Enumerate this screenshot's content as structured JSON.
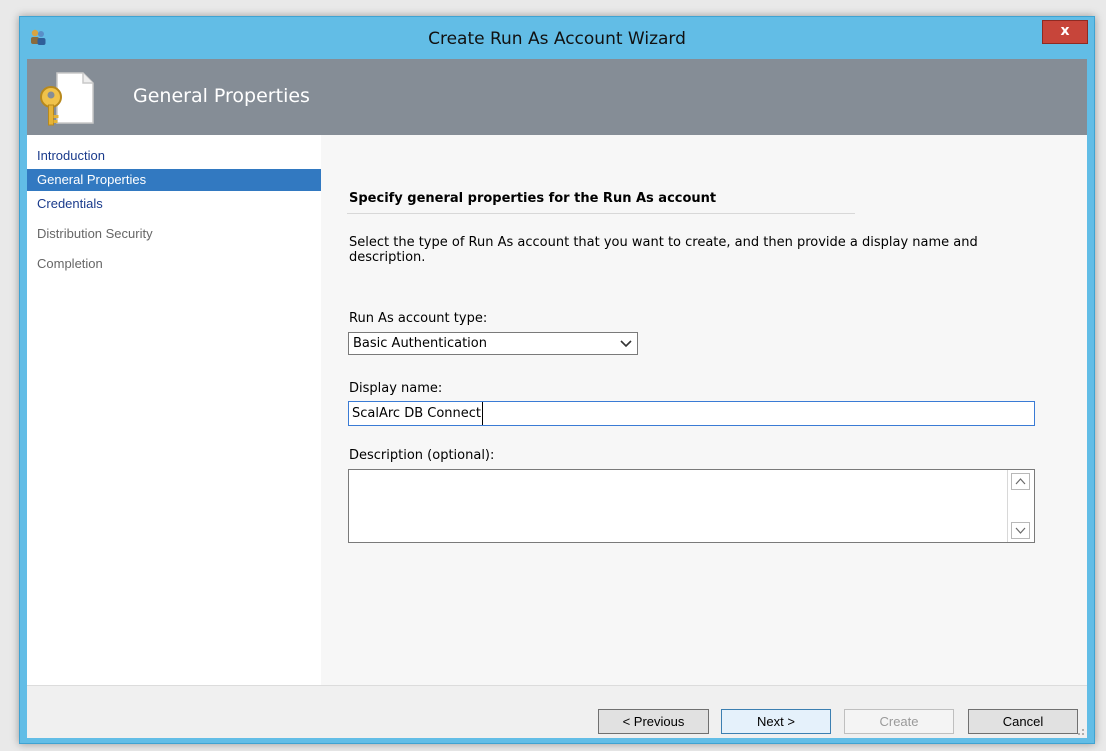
{
  "window": {
    "title": "Create Run As Account Wizard",
    "close_label": "x"
  },
  "header": {
    "title": "General Properties"
  },
  "nav": {
    "items": [
      {
        "label": "Introduction",
        "state": "visited"
      },
      {
        "label": "General Properties",
        "state": "active"
      },
      {
        "label": "Credentials",
        "state": "visited"
      },
      {
        "label": "Distribution Security",
        "state": "pending"
      },
      {
        "label": "Completion",
        "state": "pending"
      }
    ]
  },
  "main": {
    "heading": "Specify general properties for the Run As account",
    "description": "Select the type of Run As account that you want to create, and then provide a display name and description.",
    "account_type_label": "Run As account type:",
    "account_type_value": "Basic Authentication",
    "display_name_label": "Display name:",
    "display_name_value": "ScalArc DB Connect",
    "description_label": "Description (optional):",
    "description_value": ""
  },
  "footer": {
    "previous_label": "< Previous",
    "next_label": "Next >",
    "create_label": "Create",
    "cancel_label": "Cancel"
  },
  "colors": {
    "frame": "#62bde6",
    "header_band": "#858d96",
    "nav_active": "#3279c1",
    "close_button": "#c7453a"
  }
}
